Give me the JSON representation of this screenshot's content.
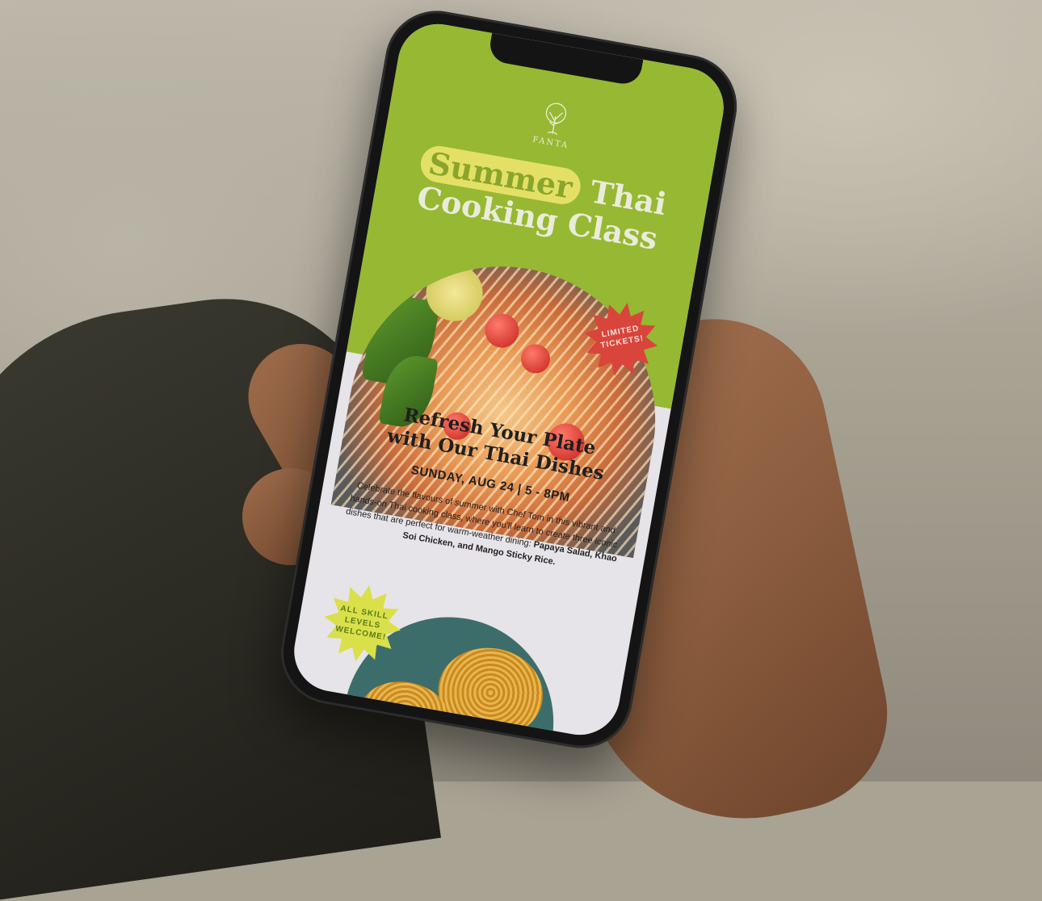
{
  "brand": {
    "name": "FANTA"
  },
  "hero": {
    "title_highlight": "Summer",
    "title_rest_line1": "Thai",
    "title_line2": "Cooking Class",
    "badge": "LIMITED TICKETS!"
  },
  "content": {
    "headline_line1": "Refresh Your Plate",
    "headline_line2": "with Our Thai Dishes",
    "date": "SUNDAY, AUG 24  |  5 - 8PM",
    "body_plain": "Celebrate the flavours of summer with Chef Tom in this vibrant and hands-on Thai cooking class, where you'll learn to create three iconic dishes that are perfect for warm-weather dining: ",
    "body_bold": "Papaya Salad, Khao Soi Chicken, and Mango Sticky Rice.",
    "badge": "ALL SKILL LEVELS WELCOME!"
  },
  "colors": {
    "hero_green": "#97b832",
    "highlight_yellow": "#e4e066",
    "badge_red": "#d9453b",
    "badge_yellow": "#d9e04a"
  },
  "icons": [
    "tree-logo-icon"
  ]
}
